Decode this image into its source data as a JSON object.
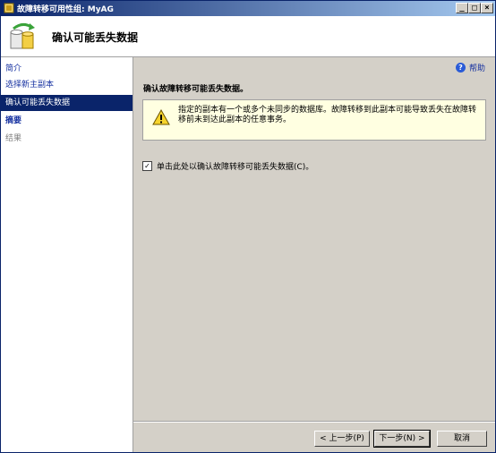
{
  "window": {
    "title": "故障转移可用性组: MyAG",
    "minimize_glyph": "_",
    "maximize_glyph": "□",
    "close_glyph": "×"
  },
  "header": {
    "title": "确认可能丢失数据"
  },
  "nav": {
    "items": [
      {
        "label": "简介"
      },
      {
        "label": "选择新主副本"
      },
      {
        "label": "确认可能丢失数据"
      },
      {
        "label": "摘要"
      },
      {
        "label": "结果"
      }
    ]
  },
  "main": {
    "help_label": "帮助",
    "heading": "确认故障转移可能丢失数据。",
    "warning_text": "指定的副本有一个或多个未同步的数据库。故障转移到此副本可能导致丢失在故障转移前未到达此副本的任意事务。",
    "checkbox_label": "单击此处以确认故障转移可能丢失数据(C)。",
    "checkbox_checked": true
  },
  "footer": {
    "prev_label": "< 上一步(P)",
    "next_label": "下一步(N) >",
    "cancel_label": "取消"
  },
  "colors": {
    "titlebar_start": "#0a246a",
    "titlebar_end": "#a6caf0",
    "nav_active_bg": "#0a246a",
    "link_color": "#1530a0",
    "warning_bg": "#ffffe1"
  }
}
